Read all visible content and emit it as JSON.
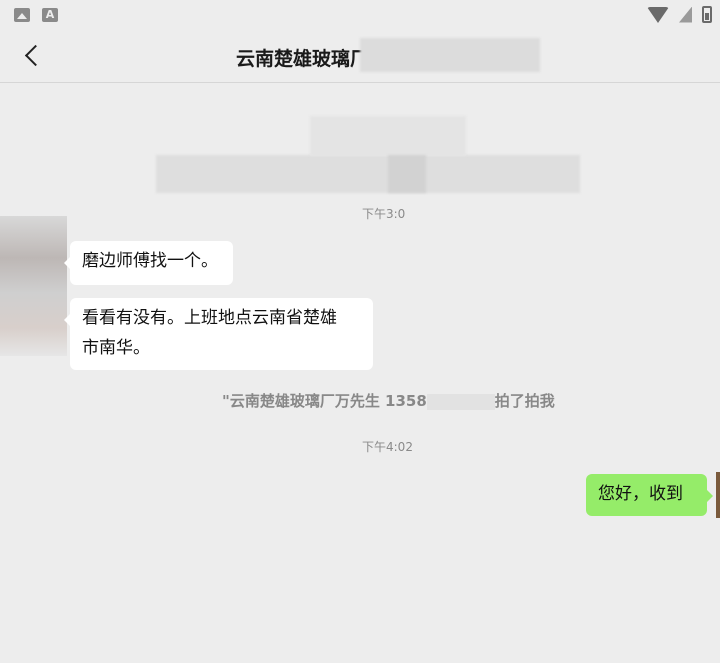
{
  "status_bar": {
    "icons": [
      "image-icon",
      "a-icon",
      "wifi-icon",
      "no-sim-icon",
      "battery-charging-icon"
    ]
  },
  "nav": {
    "title": "云南楚雄玻璃厂"
  },
  "messages": {
    "top_timestamp": "下午3:0",
    "bubble1": "磨边师傅找一个。",
    "bubble2_line1": "看看有没有。上班地点云南省楚雄",
    "bubble2_line2": "市南华。",
    "system_part1": "\"云南楚雄玻璃厂万先生 1358",
    "system_part2": "拍了拍我",
    "timestamp2": "下午4:02",
    "my_reply": "您好，收到"
  },
  "colors": {
    "background": "#ededed",
    "my_bubble": "#95ec69",
    "other_bubble": "#ffffff"
  }
}
